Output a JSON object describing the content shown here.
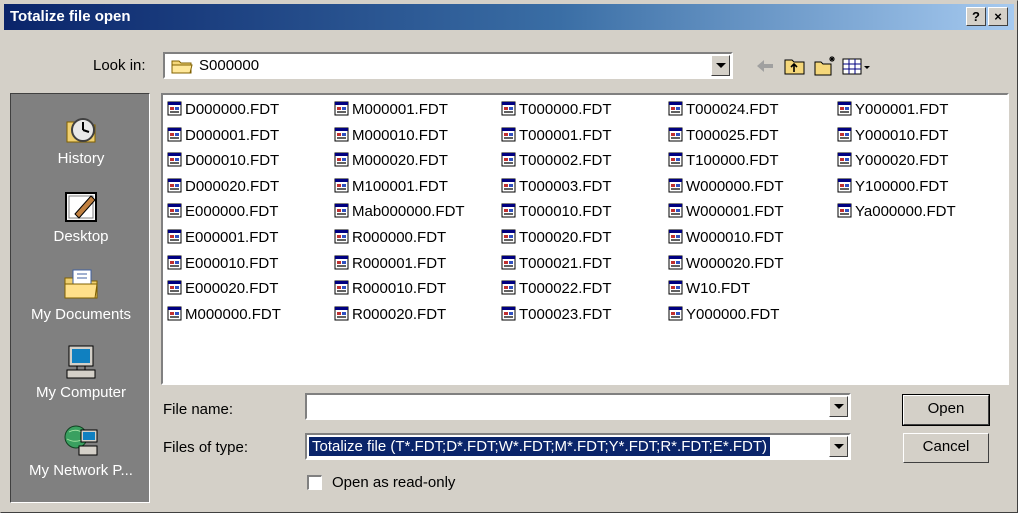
{
  "window": {
    "title": "Totalize file open",
    "help_glyph": "?",
    "close_glyph": "×"
  },
  "lookin": {
    "label": "Look in:",
    "value": "S000000"
  },
  "toolbar": {
    "icons": [
      "back-arrow-icon",
      "up-folder-icon",
      "new-folder-icon",
      "view-menu-icon"
    ]
  },
  "places": [
    {
      "label": "History",
      "icon": "history-icon"
    },
    {
      "label": "Desktop",
      "icon": "desktop-icon"
    },
    {
      "label": "My Documents",
      "icon": "my-documents-icon"
    },
    {
      "label": "My Computer",
      "icon": "my-computer-icon"
    },
    {
      "label": "My Network P...",
      "icon": "my-network-icon"
    }
  ],
  "files": {
    "columns": [
      [
        "D000000.FDT",
        "D000001.FDT",
        "D000010.FDT",
        "D000020.FDT",
        "E000000.FDT",
        "E000001.FDT",
        "E000010.FDT",
        "E000020.FDT",
        "M000000.FDT"
      ],
      [
        "M000001.FDT",
        "M000010.FDT",
        "M000020.FDT",
        "M100001.FDT",
        "Mab000000.FDT",
        "R000000.FDT",
        "R000001.FDT",
        "R000010.FDT",
        "R000020.FDT"
      ],
      [
        "T000000.FDT",
        "T000001.FDT",
        "T000002.FDT",
        "T000003.FDT",
        "T000010.FDT",
        "T000020.FDT",
        "T000021.FDT",
        "T000022.FDT",
        "T000023.FDT"
      ],
      [
        "T000024.FDT",
        "T000025.FDT",
        "T100000.FDT",
        "W000000.FDT",
        "W000001.FDT",
        "W000010.FDT",
        "W000020.FDT",
        "W10.FDT",
        "Y000000.FDT"
      ],
      [
        "Y000001.FDT",
        "Y000010.FDT",
        "Y000020.FDT",
        "Y100000.FDT",
        "Ya000000.FDT"
      ]
    ]
  },
  "filename": {
    "label": "File name:",
    "value": ""
  },
  "filetype": {
    "label": "Files of type:",
    "value": "Totalize file (T*.FDT;D*.FDT;W*.FDT;M*.FDT;Y*.FDT;R*.FDT;E*.FDT)"
  },
  "readonly": {
    "label": "Open as read-only",
    "checked": false
  },
  "buttons": {
    "open": "Open",
    "cancel": "Cancel"
  },
  "colors": {
    "title_start": "#0a246a",
    "title_end": "#a6caf0",
    "face": "#d4d0c8",
    "places_bg": "#808080",
    "selection": "#0a246a"
  }
}
